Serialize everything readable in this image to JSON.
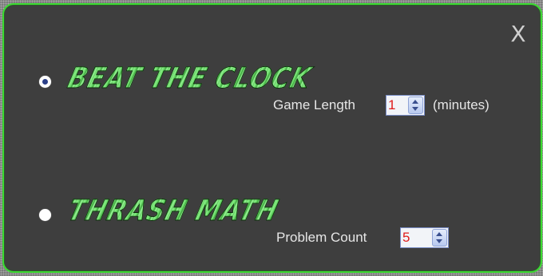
{
  "dialog": {
    "close_label": "X"
  },
  "modes": {
    "beat_the_clock": {
      "title": "BEAT THE CLOCK",
      "selected": true,
      "field_label": "Game Length",
      "value": "1",
      "unit": "(minutes)"
    },
    "thrash_math": {
      "title": "THRASH MATH",
      "selected": false,
      "field_label": "Problem Count",
      "value": "5"
    }
  },
  "colors": {
    "panel": "#3e3e3e",
    "border": "#3bdc31",
    "title_green": "#6ddc6b",
    "value_red": "#e01b1b"
  }
}
